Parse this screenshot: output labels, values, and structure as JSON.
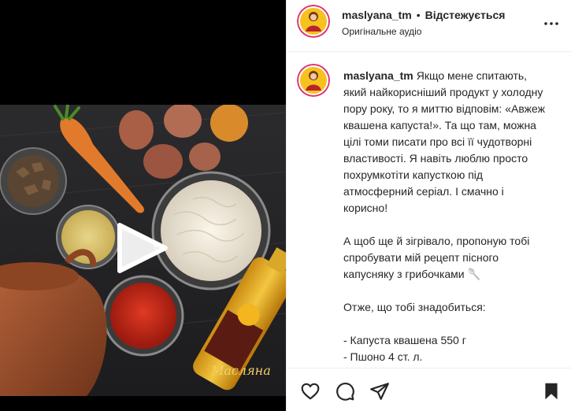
{
  "post": {
    "username": "maslyana_tm",
    "follow_status": "Відстежується",
    "audio": "Оригінальне аудіо",
    "bullet": "•"
  },
  "caption": {
    "username": "maslyana_tm",
    "paragraph1": "Якщо мене спитають, який найкорисніший продукт у холодну пору року, то я миттю відповім: «Авжеж квашена капуста!». Та що там, можна цілі томи писати про всі її чудотворні властивості. Я навіть люблю просто похрумкотіти капусткою під атмосферний серіал. І смачно і корисно!",
    "paragraph2": "А щоб ще й зігрівало, пропоную тобі спробувати мій рецепт пісного капусняку з грибочками 🥄",
    "paragraph3": "Отже, що тобі знадобиться:",
    "ingredient1": "- Капуста квашена 550 г",
    "ingredient2": "- Пшоно 4 ст. л."
  },
  "media": {
    "brand_label": "Масляна"
  },
  "icons": {
    "more": "more-icon",
    "like": "heart-icon",
    "comment": "comment-icon",
    "share": "share-icon",
    "save": "bookmark-icon",
    "play": "play-icon"
  },
  "colors": {
    "text": "#262626",
    "border": "#efefef",
    "media_bg": "#000000"
  }
}
